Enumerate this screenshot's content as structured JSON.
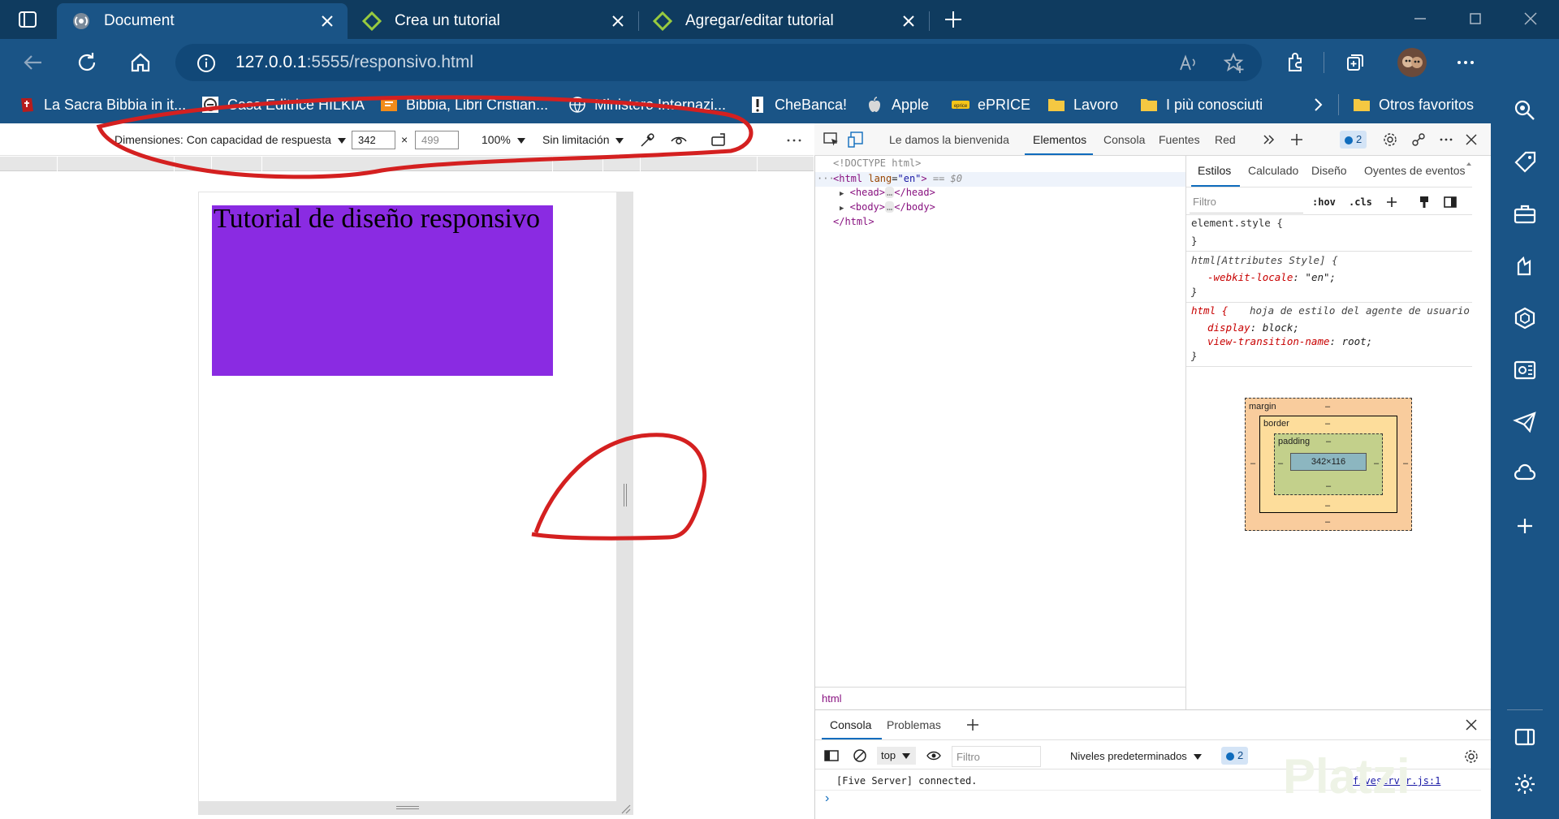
{
  "tabs": [
    {
      "title": "Document",
      "active": true
    },
    {
      "title": "Crea un tutorial",
      "active": false
    },
    {
      "title": "Agregar/editar tutorial",
      "active": false
    }
  ],
  "address": {
    "host": "127.0.0.1",
    "rest": ":5555/responsivo.html"
  },
  "bookmarks": [
    {
      "label": "La Sacra Bibbia in it...",
      "icon": "bible-icon"
    },
    {
      "label": "Casa Editrice HILKIA",
      "icon": "hilkia-icon"
    },
    {
      "label": "Bibbia, Libri Cristian...",
      "icon": "book-icon"
    },
    {
      "label": "Ministero Internazi...",
      "icon": "globe-icon"
    },
    {
      "label": "CheBanca!",
      "icon": "exclamation-icon"
    },
    {
      "label": "Apple",
      "icon": "apple-icon"
    },
    {
      "label": "ePRICE",
      "icon": "eprice-icon"
    },
    {
      "label": "Lavoro",
      "icon": "folder-icon"
    },
    {
      "label": "I più conosciuti",
      "icon": "folder-icon"
    },
    {
      "label": "Otros favoritos",
      "icon": "folder-icon"
    }
  ],
  "device_toolbar": {
    "dimensions": "Dimensiones: Con capacidad de respuesta",
    "width": "342",
    "height": "499",
    "times": "×",
    "zoom": "100%",
    "throttle": "Sin limitación"
  },
  "page": {
    "heading": "Tutorial de diseño responsivo",
    "box_color": "#8a2be2"
  },
  "devtools": {
    "tabs": [
      "Le damos la bienvenida",
      "Elementos",
      "Consola",
      "Fuentes",
      "Red"
    ],
    "active_tab": "Elementos",
    "issues": "2",
    "dom": {
      "doctype": "<!DOCTYPE html>",
      "html_open_tag": "<html",
      "lang_attr": "lang",
      "lang_value": "\"en\"",
      "html_close_bracket": ">",
      "selected_marker": "== $0",
      "head": "<head>",
      "head_close": "</head>",
      "body": "<body>",
      "body_close": "</body>",
      "html_close": "</html>",
      "ellipsis": "…",
      "dots": "···"
    },
    "breadcrumb": "html",
    "styles": {
      "tabs": [
        "Estilos",
        "Calculado",
        "Diseño",
        "Oyentes de eventos"
      ],
      "filter_placeholder": "Filtro",
      "hov": ":hov",
      "cls": ".cls",
      "rule1_selector": "element.style {",
      "rule1_close": "}",
      "rule2_selector": "html[Attributes Style] {",
      "rule2_prop": "-webkit-locale",
      "rule2_value": "\"en\";",
      "rule2_close": "}",
      "rule3_selector": "html {",
      "rule3_source": "hoja de estilo del agente de usuario",
      "rule3_prop1": "display",
      "rule3_val1": "block;",
      "rule3_prop2": "view-transition-name",
      "rule3_val2": "root;",
      "rule3_close": "}",
      "colon": ":"
    },
    "box_model": {
      "margin_label": "margin",
      "border_label": "border",
      "padding_label": "padding",
      "content": "342×116",
      "dash": "–"
    },
    "drawer": {
      "tabs": [
        "Consola",
        "Problemas"
      ],
      "context": "top",
      "filter_placeholder": "Filtro",
      "levels": "Niveles predeterminados",
      "issues": "2",
      "message": "[Five Server] connected.",
      "source": "fiveserver.js:1",
      "prompt": "›"
    }
  },
  "colors": {
    "titlebar": "#0f3b5f",
    "toolbar": "#1a5486",
    "annotation": "#d42020",
    "accent": "#0f6cbd"
  }
}
